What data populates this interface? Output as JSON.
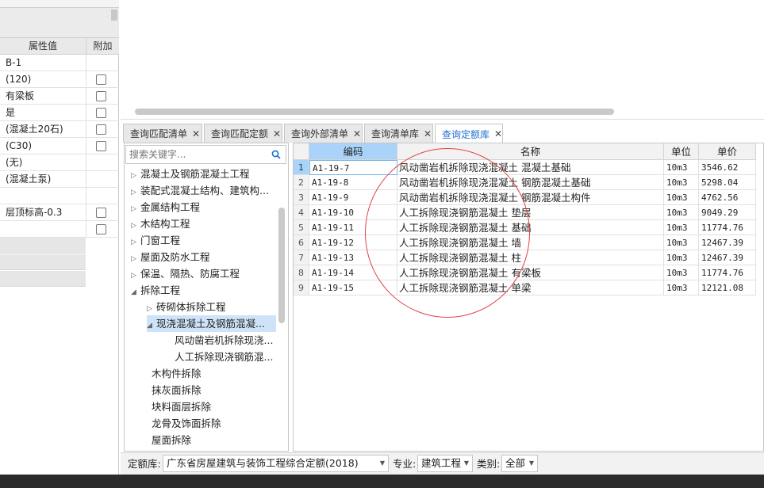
{
  "properties": {
    "header_value": "属性值",
    "header_add": "附加",
    "rows": [
      {
        "value": "B-1",
        "checkbox": false
      },
      {
        "value": "(120)",
        "checkbox": true
      },
      {
        "value": "有梁板",
        "checkbox": true
      },
      {
        "value": "是",
        "checkbox": true
      },
      {
        "value": "(混凝土20石)",
        "checkbox": true
      },
      {
        "value": "(C30)",
        "checkbox": true
      },
      {
        "value": "(无)",
        "checkbox": false
      },
      {
        "value": "(混凝土泵)",
        "checkbox": false
      },
      {
        "value": "",
        "checkbox": false
      },
      {
        "value": "层顶标高-0.3",
        "checkbox": true
      },
      {
        "value": "",
        "checkbox": true
      }
    ]
  },
  "tabs": [
    {
      "label": "查询匹配清单",
      "active": false
    },
    {
      "label": "查询匹配定额",
      "active": false
    },
    {
      "label": "查询外部清单",
      "active": false
    },
    {
      "label": "查询清单库",
      "active": false
    },
    {
      "label": "查询定额库",
      "active": true
    }
  ],
  "search": {
    "placeholder": "搜索关键字..."
  },
  "tree": [
    {
      "label": "混凝土及钢筋混凝土工程",
      "arrow": "▷",
      "level": 0
    },
    {
      "label": "装配式混凝土结构、建筑构...",
      "arrow": "▷",
      "level": 0
    },
    {
      "label": "金属结构工程",
      "arrow": "▷",
      "level": 0
    },
    {
      "label": "木结构工程",
      "arrow": "▷",
      "level": 0
    },
    {
      "label": "门窗工程",
      "arrow": "▷",
      "level": 0
    },
    {
      "label": "屋面及防水工程",
      "arrow": "▷",
      "level": 0
    },
    {
      "label": "保温、隔热、防腐工程",
      "arrow": "▷",
      "level": 0
    },
    {
      "label": "拆除工程",
      "arrow": "◢",
      "level": 0
    },
    {
      "label": "砖砌体拆除工程",
      "arrow": "▷",
      "level": 1
    },
    {
      "label": "现浇混凝土及钢筋混凝...",
      "arrow": "◢",
      "level": 1,
      "selected": true
    },
    {
      "label": "风动凿岩机拆除现浇...",
      "arrow": "",
      "level": 2
    },
    {
      "label": "人工拆除现浇钢筋混...",
      "arrow": "",
      "level": 2
    },
    {
      "label": "木构件拆除",
      "arrow": "",
      "level": 1
    },
    {
      "label": "抹灰面拆除",
      "arrow": "",
      "level": 1
    },
    {
      "label": "块料面层拆除",
      "arrow": "",
      "level": 1
    },
    {
      "label": "龙骨及饰面拆除",
      "arrow": "",
      "level": 1
    },
    {
      "label": "屋面拆除",
      "arrow": "",
      "level": 1
    }
  ],
  "grid": {
    "headers": {
      "code": "编码",
      "name": "名称",
      "unit": "单位",
      "price": "单价"
    },
    "rows": [
      {
        "idx": "1",
        "code": "A1-19-7",
        "name": "风动凿岩机拆除现浇混凝土 混凝土基础",
        "unit": "10m3",
        "price": "3546.62"
      },
      {
        "idx": "2",
        "code": "A1-19-8",
        "name": "风动凿岩机拆除现浇混凝土 钢筋混凝土基础",
        "unit": "10m3",
        "price": "5298.04"
      },
      {
        "idx": "3",
        "code": "A1-19-9",
        "name": "风动凿岩机拆除现浇混凝土 钢筋混凝土构件",
        "unit": "10m3",
        "price": "4762.56"
      },
      {
        "idx": "4",
        "code": "A1-19-10",
        "name": "人工拆除现浇钢筋混凝土 垫层",
        "unit": "10m3",
        "price": "9049.29"
      },
      {
        "idx": "5",
        "code": "A1-19-11",
        "name": "人工拆除现浇钢筋混凝土 基础",
        "unit": "10m3",
        "price": "11774.76"
      },
      {
        "idx": "6",
        "code": "A1-19-12",
        "name": "人工拆除现浇钢筋混凝土 墙",
        "unit": "10m3",
        "price": "12467.39"
      },
      {
        "idx": "7",
        "code": "A1-19-13",
        "name": "人工拆除现浇钢筋混凝土 柱",
        "unit": "10m3",
        "price": "12467.39"
      },
      {
        "idx": "8",
        "code": "A1-19-14",
        "name": "人工拆除现浇钢筋混凝土 有梁板",
        "unit": "10m3",
        "price": "11774.76"
      },
      {
        "idx": "9",
        "code": "A1-19-15",
        "name": "人工拆除现浇钢筋混凝土 单梁",
        "unit": "10m3",
        "price": "12121.08"
      }
    ]
  },
  "footer": {
    "quota_label": "定额库:",
    "quota_value": "广东省房屋建筑与装饰工程综合定额(2018)",
    "specialty_label": "专业:",
    "specialty_value": "建筑工程",
    "category_label": "类别:",
    "category_value": "全部"
  },
  "colors": {
    "accent": "#1f6fd1",
    "selected_bg": "#a9d3f8",
    "annotation": "#e04545"
  }
}
